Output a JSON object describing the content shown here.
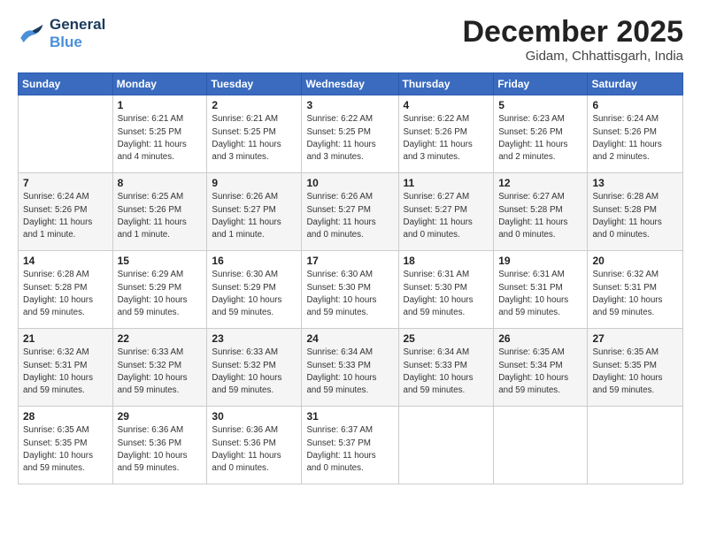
{
  "header": {
    "logo_line1": "General",
    "logo_line2": "Blue",
    "month_title": "December 2025",
    "location": "Gidam, Chhattisgarh, India"
  },
  "weekdays": [
    "Sunday",
    "Monday",
    "Tuesday",
    "Wednesday",
    "Thursday",
    "Friday",
    "Saturday"
  ],
  "weeks": [
    [
      {
        "day": "",
        "info": ""
      },
      {
        "day": "1",
        "info": "Sunrise: 6:21 AM\nSunset: 5:25 PM\nDaylight: 11 hours\nand 4 minutes."
      },
      {
        "day": "2",
        "info": "Sunrise: 6:21 AM\nSunset: 5:25 PM\nDaylight: 11 hours\nand 3 minutes."
      },
      {
        "day": "3",
        "info": "Sunrise: 6:22 AM\nSunset: 5:25 PM\nDaylight: 11 hours\nand 3 minutes."
      },
      {
        "day": "4",
        "info": "Sunrise: 6:22 AM\nSunset: 5:26 PM\nDaylight: 11 hours\nand 3 minutes."
      },
      {
        "day": "5",
        "info": "Sunrise: 6:23 AM\nSunset: 5:26 PM\nDaylight: 11 hours\nand 2 minutes."
      },
      {
        "day": "6",
        "info": "Sunrise: 6:24 AM\nSunset: 5:26 PM\nDaylight: 11 hours\nand 2 minutes."
      }
    ],
    [
      {
        "day": "7",
        "info": "Sunrise: 6:24 AM\nSunset: 5:26 PM\nDaylight: 11 hours\nand 1 minute."
      },
      {
        "day": "8",
        "info": "Sunrise: 6:25 AM\nSunset: 5:26 PM\nDaylight: 11 hours\nand 1 minute."
      },
      {
        "day": "9",
        "info": "Sunrise: 6:26 AM\nSunset: 5:27 PM\nDaylight: 11 hours\nand 1 minute."
      },
      {
        "day": "10",
        "info": "Sunrise: 6:26 AM\nSunset: 5:27 PM\nDaylight: 11 hours\nand 0 minutes."
      },
      {
        "day": "11",
        "info": "Sunrise: 6:27 AM\nSunset: 5:27 PM\nDaylight: 11 hours\nand 0 minutes."
      },
      {
        "day": "12",
        "info": "Sunrise: 6:27 AM\nSunset: 5:28 PM\nDaylight: 11 hours\nand 0 minutes."
      },
      {
        "day": "13",
        "info": "Sunrise: 6:28 AM\nSunset: 5:28 PM\nDaylight: 11 hours\nand 0 minutes."
      }
    ],
    [
      {
        "day": "14",
        "info": "Sunrise: 6:28 AM\nSunset: 5:28 PM\nDaylight: 10 hours\nand 59 minutes."
      },
      {
        "day": "15",
        "info": "Sunrise: 6:29 AM\nSunset: 5:29 PM\nDaylight: 10 hours\nand 59 minutes."
      },
      {
        "day": "16",
        "info": "Sunrise: 6:30 AM\nSunset: 5:29 PM\nDaylight: 10 hours\nand 59 minutes."
      },
      {
        "day": "17",
        "info": "Sunrise: 6:30 AM\nSunset: 5:30 PM\nDaylight: 10 hours\nand 59 minutes."
      },
      {
        "day": "18",
        "info": "Sunrise: 6:31 AM\nSunset: 5:30 PM\nDaylight: 10 hours\nand 59 minutes."
      },
      {
        "day": "19",
        "info": "Sunrise: 6:31 AM\nSunset: 5:31 PM\nDaylight: 10 hours\nand 59 minutes."
      },
      {
        "day": "20",
        "info": "Sunrise: 6:32 AM\nSunset: 5:31 PM\nDaylight: 10 hours\nand 59 minutes."
      }
    ],
    [
      {
        "day": "21",
        "info": "Sunrise: 6:32 AM\nSunset: 5:31 PM\nDaylight: 10 hours\nand 59 minutes."
      },
      {
        "day": "22",
        "info": "Sunrise: 6:33 AM\nSunset: 5:32 PM\nDaylight: 10 hours\nand 59 minutes."
      },
      {
        "day": "23",
        "info": "Sunrise: 6:33 AM\nSunset: 5:32 PM\nDaylight: 10 hours\nand 59 minutes."
      },
      {
        "day": "24",
        "info": "Sunrise: 6:34 AM\nSunset: 5:33 PM\nDaylight: 10 hours\nand 59 minutes."
      },
      {
        "day": "25",
        "info": "Sunrise: 6:34 AM\nSunset: 5:33 PM\nDaylight: 10 hours\nand 59 minutes."
      },
      {
        "day": "26",
        "info": "Sunrise: 6:35 AM\nSunset: 5:34 PM\nDaylight: 10 hours\nand 59 minutes."
      },
      {
        "day": "27",
        "info": "Sunrise: 6:35 AM\nSunset: 5:35 PM\nDaylight: 10 hours\nand 59 minutes."
      }
    ],
    [
      {
        "day": "28",
        "info": "Sunrise: 6:35 AM\nSunset: 5:35 PM\nDaylight: 10 hours\nand 59 minutes."
      },
      {
        "day": "29",
        "info": "Sunrise: 6:36 AM\nSunset: 5:36 PM\nDaylight: 10 hours\nand 59 minutes."
      },
      {
        "day": "30",
        "info": "Sunrise: 6:36 AM\nSunset: 5:36 PM\nDaylight: 11 hours\nand 0 minutes."
      },
      {
        "day": "31",
        "info": "Sunrise: 6:37 AM\nSunset: 5:37 PM\nDaylight: 11 hours\nand 0 minutes."
      },
      {
        "day": "",
        "info": ""
      },
      {
        "day": "",
        "info": ""
      },
      {
        "day": "",
        "info": ""
      }
    ]
  ]
}
